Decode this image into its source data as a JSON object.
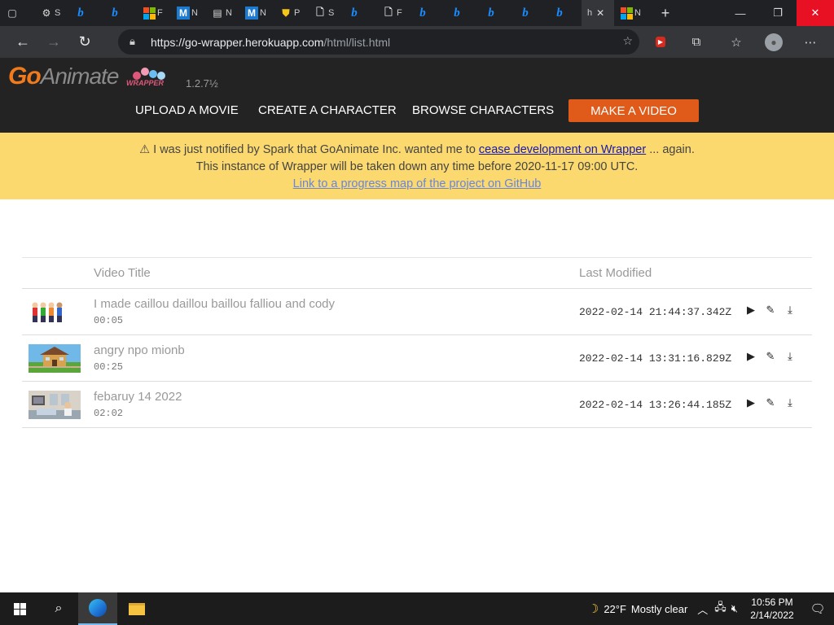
{
  "browser": {
    "tabs": [
      {
        "icon": "window-icon",
        "text": ""
      },
      {
        "icon": "gear-icon",
        "text": "S"
      },
      {
        "icon": "bing-icon",
        "text": ""
      },
      {
        "icon": "bing-icon",
        "text": ""
      },
      {
        "icon": "microsoft-icon",
        "text": "F"
      },
      {
        "icon": "m-icon",
        "text": "N"
      },
      {
        "icon": "calendar-icon",
        "text": "N"
      },
      {
        "icon": "m-icon",
        "text": "N"
      },
      {
        "icon": "shield-icon",
        "text": "P"
      },
      {
        "icon": "page-icon",
        "text": "S"
      },
      {
        "icon": "bing-icon",
        "text": ""
      },
      {
        "icon": "page-icon",
        "text": "F"
      },
      {
        "icon": "bing-icon",
        "text": ""
      },
      {
        "icon": "bing-icon",
        "text": ""
      },
      {
        "icon": "bing-icon",
        "text": ""
      },
      {
        "icon": "bing-icon",
        "text": ""
      },
      {
        "icon": "bing-icon",
        "text": ""
      },
      {
        "icon": "text",
        "text": "h",
        "active": true
      },
      {
        "icon": "microsoft-icon",
        "text": "N"
      }
    ],
    "url_host": "https://go-wrapper.herokuapp.com",
    "url_path": "/html/list.html"
  },
  "site": {
    "logo_go": "Go",
    "logo_animate": "Animate",
    "logo_wrapper": "WRAPPER",
    "version": "1.2.7½",
    "nav": {
      "upload": "UPLOAD A MOVIE",
      "create": "CREATE A CHARACTER",
      "browse": "BROWSE CHARACTERS",
      "make": "MAKE A VIDEO"
    }
  },
  "notice": {
    "line1_pre": "⚠ I was just notified by Spark that GoAnimate Inc. wanted me to ",
    "line1_link": "cease development on Wrapper",
    "line1_post": " ... again.",
    "line2": "This instance of Wrapper will be taken down any time before 2020-11-17 09:00 UTC.",
    "line3_link": "Link to a progress map of the project on GitHub"
  },
  "table": {
    "col_title": "Video Title",
    "col_modified": "Last Modified",
    "rows": [
      {
        "title": "I made caillou daillou baillou falliou and cody",
        "duration": "00:05",
        "modified": "2022-02-14 21:44:37.342Z"
      },
      {
        "title": "angry npo mionb",
        "duration": "00:25",
        "modified": "2022-02-14 13:31:16.829Z"
      },
      {
        "title": "febaruy 14 2022",
        "duration": "02:02",
        "modified": "2022-02-14 13:26:44.185Z"
      }
    ]
  },
  "taskbar": {
    "temperature": "22°F",
    "weather": "Mostly clear",
    "time": "10:56 PM",
    "date": "2/14/2022"
  }
}
